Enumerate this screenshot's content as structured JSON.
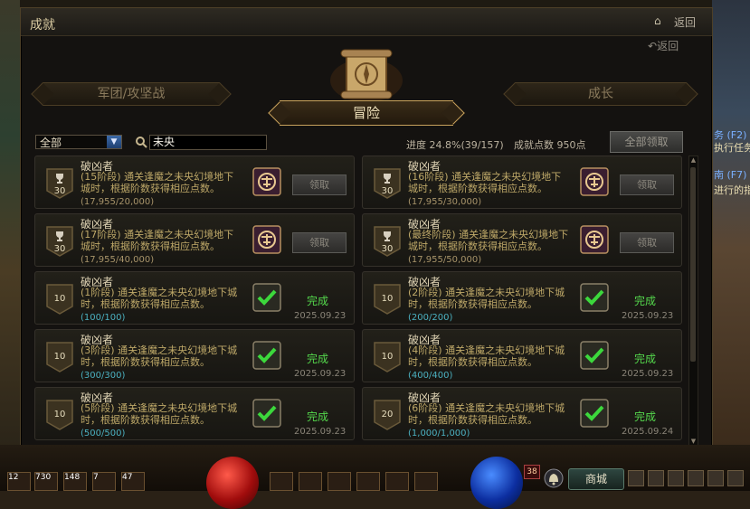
{
  "window": {
    "title": "成就",
    "back_label": "返回",
    "sub_back_label": "返回"
  },
  "tabs": {
    "left": "军团/攻坚战",
    "center": "冒险",
    "right": "成长"
  },
  "filter": {
    "category_selected": "全部",
    "search_value": "未央"
  },
  "summary": {
    "progress": "进度 24.8%(39/157)",
    "points": "成就点数 950点",
    "claim_all_label": "全部领取"
  },
  "achievements": [
    {
      "name": "破凶者",
      "desc": "(15阶段) 通关逢魔之未央幻境地下城时，根据阶数获得相应点数。",
      "progress": "(17,955/20,000)",
      "points": "30",
      "claim_label": "领取"
    },
    {
      "name": "破凶者",
      "desc": "(16阶段) 通关逢魔之未央幻境地下城时，根据阶数获得相应点数。",
      "progress": "(17,955/30,000)",
      "points": "30",
      "claim_label": "领取"
    },
    {
      "name": "破凶者",
      "desc": "(17阶段) 通关逢魔之未央幻境地下城时，根据阶数获得相应点数。",
      "progress": "(17,955/40,000)",
      "points": "30",
      "claim_label": "领取"
    },
    {
      "name": "破凶者",
      "desc": "(最终阶段) 通关逢魔之未央幻境地下城时，根据阶数获得相应点数。",
      "progress": "(17,955/50,000)",
      "points": "30",
      "claim_label": "领取"
    },
    {
      "name": "破凶者",
      "desc": "(1阶段) 通关逢魔之未央幻境地下城时，根据阶数获得相应点数。",
      "progress": "(100/100)",
      "points": "10",
      "status": "完成",
      "date": "2025.09.23"
    },
    {
      "name": "破凶者",
      "desc": "(2阶段) 通关逢魔之未央幻境地下城时，根据阶数获得相应点数。",
      "progress": "(200/200)",
      "points": "10",
      "status": "完成",
      "date": "2025.09.23"
    },
    {
      "name": "破凶者",
      "desc": "(3阶段) 通关逢魔之未央幻境地下城时，根据阶数获得相应点数。",
      "progress": "(300/300)",
      "points": "10",
      "status": "完成",
      "date": "2025.09.23"
    },
    {
      "name": "破凶者",
      "desc": "(4阶段) 通关逢魔之未央幻境地下城时，根据阶数获得相应点数。",
      "progress": "(400/400)",
      "points": "10",
      "status": "完成",
      "date": "2025.09.23"
    },
    {
      "name": "破凶者",
      "desc": "(5阶段) 通关逢魔之未央幻境地下城时，根据阶数获得相应点数。",
      "progress": "(500/500)",
      "points": "10",
      "status": "完成",
      "date": "2025.09.23"
    },
    {
      "name": "破凶者",
      "desc": "(6阶段) 通关逢魔之未央幻境地下城时，根据阶数获得相应点数。",
      "progress": "(1,000/1,000)",
      "points": "20",
      "status": "完成",
      "date": "2025.09.24"
    }
  ],
  "side": {
    "quest1": "务 (F2)",
    "quest1_sub": "执行任务",
    "quest2": "南 (F7)",
    "quest2_sub": "进行的指"
  },
  "hud": {
    "mall_label": "商城",
    "level": "38",
    "slot_values": [
      "12",
      "730",
      "148",
      "7",
      "47"
    ]
  },
  "colors": {
    "done_green": "#54d84c",
    "title_gold": "#c8a25c",
    "progress_done": "#4bb0c0"
  }
}
